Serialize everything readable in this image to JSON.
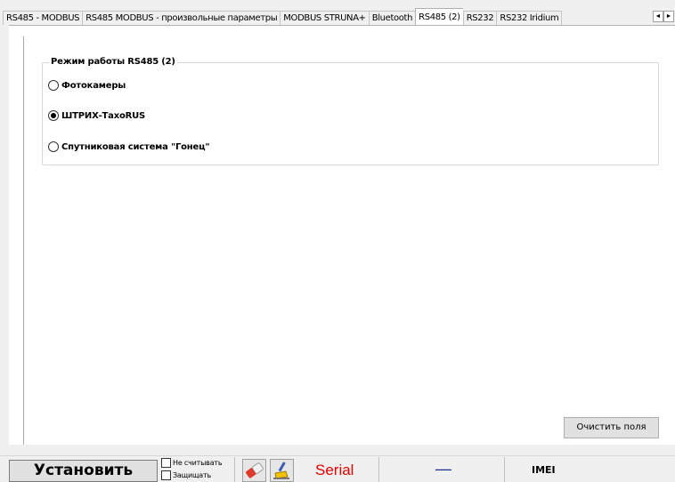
{
  "tabs": [
    {
      "label": "RS485 - MODBUS",
      "active": false
    },
    {
      "label": "RS485 MODBUS - произвольные параметры",
      "active": false
    },
    {
      "label": "MODBUS STRUNA+",
      "active": false
    },
    {
      "label": "Bluetooth",
      "active": false
    },
    {
      "label": "RS485 (2)",
      "active": true
    },
    {
      "label": "RS232",
      "active": false
    },
    {
      "label": "RS232 Iridium",
      "active": false
    }
  ],
  "tab_scroll": {
    "left_icon": "arrow-left-icon",
    "right_icon": "arrow-right-icon",
    "left_glyph": "◄",
    "right_glyph": "►"
  },
  "mode_group": {
    "title": "Режим работы RS485 (2)",
    "options": [
      {
        "label": "Фотокамеры",
        "selected": false
      },
      {
        "label": "ШТРИХ-ТахоRUS",
        "selected": true
      },
      {
        "label": "Спутниковая система \"Гонец\"",
        "selected": false
      }
    ]
  },
  "clear_button": "Очистить поля",
  "bottom": {
    "install_button": "Установить",
    "checkboxes": [
      {
        "label": "Не считывать",
        "checked": false
      },
      {
        "label": "Защищать",
        "checked": false
      }
    ],
    "icons": [
      "eraser-icon",
      "brush-icon"
    ],
    "serial": "Serial",
    "dash": "—",
    "imei": "IMEI",
    "colors": {
      "serial": "#e00000",
      "dash": "#1b2f8f"
    }
  }
}
